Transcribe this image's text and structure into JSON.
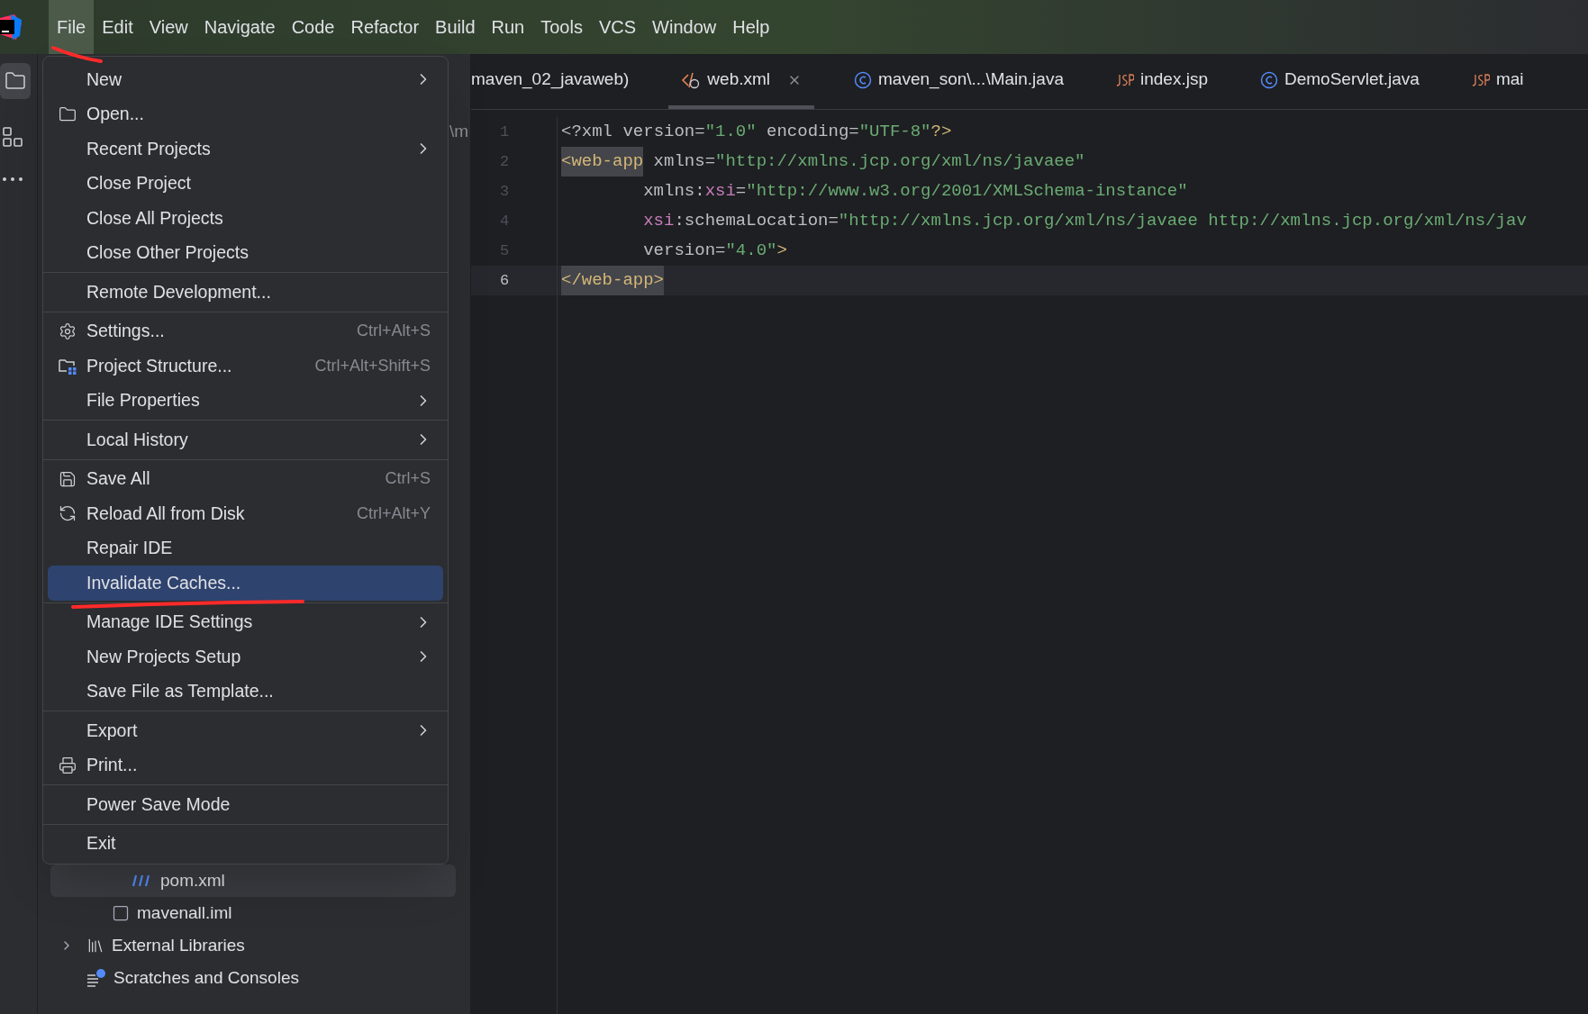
{
  "menu_bar": [
    {
      "label": "File",
      "selected": true
    },
    {
      "label": "Edit",
      "selected": false
    },
    {
      "label": "View",
      "selected": false
    },
    {
      "label": "Navigate",
      "selected": false
    },
    {
      "label": "Code",
      "selected": false
    },
    {
      "label": "Refactor",
      "selected": false
    },
    {
      "label": "Build",
      "selected": false
    },
    {
      "label": "Run",
      "selected": false
    },
    {
      "label": "Tools",
      "selected": false
    },
    {
      "label": "VCS",
      "selected": false
    },
    {
      "label": "Window",
      "selected": false
    },
    {
      "label": "Help",
      "selected": false
    }
  ],
  "file_menu": [
    [
      {
        "label": "New",
        "submenu": true,
        "selected": false
      },
      {
        "label": "Open...",
        "kind": "folder",
        "selected": false
      },
      {
        "label": "Recent Projects",
        "submenu": true,
        "selected": false
      },
      {
        "label": "Close Project",
        "selected": false
      },
      {
        "label": "Close All Projects",
        "selected": false
      },
      {
        "label": "Close Other Projects",
        "selected": false
      }
    ],
    [
      {
        "label": "Remote Development...",
        "selected": false
      }
    ],
    [
      {
        "label": "Settings...",
        "kind": "gear",
        "shortcut": "Ctrl+Alt+S",
        "selected": false
      },
      {
        "label": "Project Structure...",
        "kind": "structure",
        "shortcut": "Ctrl+Alt+Shift+S",
        "selected": false
      },
      {
        "label": "File Properties",
        "submenu": true,
        "selected": false
      }
    ],
    [
      {
        "label": "Local History",
        "submenu": true,
        "selected": false
      }
    ],
    [
      {
        "label": "Save All",
        "kind": "save",
        "shortcut": "Ctrl+S",
        "selected": false
      },
      {
        "label": "Reload All from Disk",
        "kind": "reload",
        "shortcut": "Ctrl+Alt+Y",
        "selected": false
      },
      {
        "label": "Repair IDE",
        "selected": false
      },
      {
        "label": "Invalidate Caches...",
        "selected": true
      }
    ],
    [
      {
        "label": "Manage IDE Settings",
        "submenu": true,
        "selected": false
      },
      {
        "label": "New Projects Setup",
        "submenu": true,
        "selected": false
      },
      {
        "label": "Save File as Template...",
        "selected": false
      }
    ],
    [
      {
        "label": "Export",
        "submenu": true,
        "selected": false
      },
      {
        "label": "Print...",
        "kind": "print",
        "selected": false
      }
    ],
    [
      {
        "label": "Power Save Mode",
        "selected": false
      }
    ],
    [
      {
        "label": "Exit",
        "selected": false
      }
    ]
  ],
  "project_tree": {
    "peek_text": "\\m",
    "items": [
      {
        "label": "pom.xml",
        "kind": "maven",
        "selected": true,
        "expandable": false
      },
      {
        "label": "mavenall.iml",
        "kind": "file",
        "selected": false,
        "expandable": false
      },
      {
        "label": "External Libraries",
        "kind": "library",
        "selected": false,
        "expandable": true
      },
      {
        "label": "Scratches and Consoles",
        "kind": "scratch",
        "selected": false,
        "expandable": false
      }
    ]
  },
  "tabs": [
    {
      "label": "maven_02_javaweb)",
      "selected": false
    },
    {
      "label": "web.xml",
      "kind": "xml",
      "selected": true,
      "closable": true
    },
    {
      "label": "maven_son\\...\\Main.java",
      "kind": "class",
      "selected": false
    },
    {
      "label": "index.jsp",
      "kind": "jsp",
      "selected": false
    },
    {
      "label": "DemoServlet.java",
      "kind": "class",
      "selected": false
    },
    {
      "label": "mai",
      "kind": "jsp",
      "selected": false
    }
  ],
  "code": [
    {
      "number": "1",
      "current": false,
      "tokens": [
        {
          "kind": "plain",
          "text": "<?xml "
        },
        {
          "kind": "attr",
          "text": "version="
        },
        {
          "kind": "value",
          "text": "\"1.0\" "
        },
        {
          "kind": "attr",
          "text": "encoding="
        },
        {
          "kind": "value",
          "text": "\"UTF-8\""
        },
        {
          "kind": "tag",
          "text": "?>"
        }
      ]
    },
    {
      "number": "2",
      "current": false,
      "tokens": [
        {
          "kind": "tag",
          "text": "<web-app",
          "highlight": true
        },
        {
          "kind": "attr",
          "text": " xmlns="
        },
        {
          "kind": "value",
          "text": "\"http://xmlns.jcp.org/xml/ns/javaee\""
        }
      ]
    },
    {
      "number": "3",
      "current": false,
      "tokens": [
        {
          "kind": "attr",
          "text": "        xmlns:"
        },
        {
          "kind": "ns",
          "text": "xsi"
        },
        {
          "kind": "attr",
          "text": "="
        },
        {
          "kind": "value",
          "text": "\"http://www.w3.org/2001/XMLSchema-instance\""
        }
      ]
    },
    {
      "number": "4",
      "current": false,
      "tokens": [
        {
          "kind": "ns",
          "text": "        xsi"
        },
        {
          "kind": "attr",
          "text": ":schemaLocation="
        },
        {
          "kind": "value",
          "text": "\"http://xmlns.jcp.org/xml/ns/javaee http://xmlns.jcp.org/xml/ns/jav"
        }
      ]
    },
    {
      "number": "5",
      "current": false,
      "tokens": [
        {
          "kind": "attr",
          "text": "        version="
        },
        {
          "kind": "value",
          "text": "\"4.0\""
        },
        {
          "kind": "tag",
          "text": ">"
        }
      ]
    },
    {
      "number": "6",
      "current": true,
      "tokens": [
        {
          "kind": "tag",
          "text": "</web-app>",
          "highlight": true
        }
      ]
    }
  ]
}
